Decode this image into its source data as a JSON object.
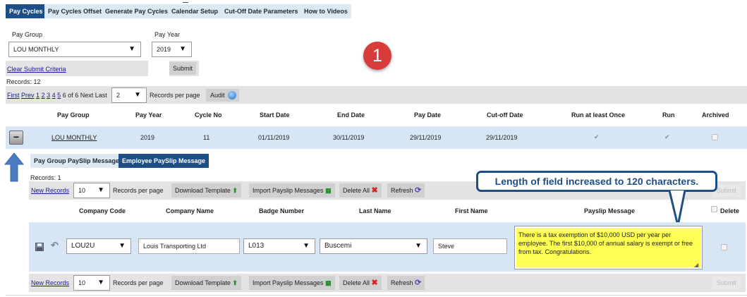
{
  "tabs": [
    {
      "label": "Pay Cycles",
      "active": true
    },
    {
      "label": "Pay Cycles Offset"
    },
    {
      "label": "Generate Pay Cycles"
    },
    {
      "label": "Calendar Setup"
    },
    {
      "label": "Cut-Off Date Parameters"
    },
    {
      "label": "How to Videos"
    }
  ],
  "filters": {
    "pay_group_label": "Pay Group",
    "pay_group_value": "LOU MONTHLY",
    "pay_year_label": "Pay Year",
    "pay_year_value": "2019",
    "clear_label": "Clear Submit Criteria",
    "submit_label": "Submit"
  },
  "step_badge": "1",
  "records_summary": "Records:  12",
  "pager": {
    "first": "First",
    "prev": "Prev",
    "pages": [
      "1",
      "2",
      "3",
      "4",
      "5"
    ],
    "of_text": "6 of 6",
    "next": "Next",
    "last": "Last",
    "per_page_value": "2",
    "per_page_label": "Records per page",
    "audit_label": "Audit"
  },
  "cycle_table": {
    "headers": [
      "Pay Group",
      "Pay Year",
      "Cycle No",
      "Start Date",
      "End Date",
      "Pay Date",
      "Cut-off Date",
      "Run at least Once",
      "Run",
      "Archived"
    ],
    "row": {
      "pay_group": "LOU MONTHLY",
      "pay_year": "2019",
      "cycle_no": "11",
      "start_date": "01/11/2019",
      "end_date": "30/11/2019",
      "pay_date": "29/11/2019",
      "cutoff_date": "29/11/2019",
      "collapse_symbol": "−",
      "tick": "✔"
    }
  },
  "subtabs": [
    {
      "label": "Pay Group PaySlip Message"
    },
    {
      "label": "Employee PaySlip Message",
      "active": true
    }
  ],
  "sub_records": "Records:  1",
  "sub_toolbar": {
    "new_records": "New Records",
    "per_page_value": "10",
    "per_page_label": "Records per page",
    "download": "Download Template",
    "import": "Import Payslip Messages",
    "delete_all": "Delete All",
    "refresh": "Refresh",
    "submit": "Submit"
  },
  "callout": "Length of field increased to 120 characters.",
  "payslip_table": {
    "headers": [
      "Company Code",
      "Company Name",
      "Badge Number",
      "Last Name",
      "First Name",
      "Payslip Message",
      "Delete"
    ],
    "row": {
      "company_code": "LOU2U",
      "company_name": "Louis Transporting Ltd",
      "badge_number": "L013",
      "last_name": "Buscemi",
      "first_name": "Steve",
      "message": "There is a tax exemption of $10,000 USD per year per employee. The first $10,000 of annual salary is exempt or free from tax.  Congratulations."
    }
  },
  "colors": {
    "tab_active": "#1d4f86",
    "tab_inactive": "#dde8f2",
    "row_highlight": "#d6e6f5",
    "callout_border": "#1d4f86",
    "message_bg": "#ffff55",
    "badge": "#d93a3a",
    "arrow": "#4a7cc4"
  }
}
